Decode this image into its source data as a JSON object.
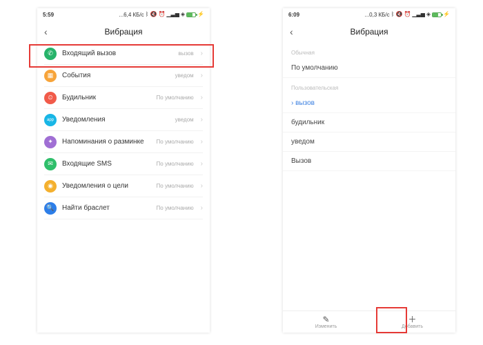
{
  "left": {
    "status": {
      "time": "5:59",
      "data": "...6,4 КБ/с"
    },
    "header": {
      "title": "Вибрация"
    },
    "rows": [
      {
        "icon": "phone",
        "color": "#27b36a",
        "label": "Входящий вызов",
        "value": "вызов"
      },
      {
        "icon": "cal",
        "color": "#f7a43a",
        "label": "События",
        "value": "уведом"
      },
      {
        "icon": "clock",
        "color": "#f15b4a",
        "label": "Будильник",
        "value": "По умолчанию"
      },
      {
        "icon": "app",
        "color": "#18b6e6",
        "label": "Уведомления",
        "value": "уведом"
      },
      {
        "icon": "bell",
        "color": "#a06fd4",
        "label": "Напоминания о разминке",
        "value": "По умолчанию"
      },
      {
        "icon": "sms",
        "color": "#2fbf6b",
        "label": "Входящие SMS",
        "value": "По умолчанию"
      },
      {
        "icon": "goal",
        "color": "#f4b02e",
        "label": "Уведомления о цели",
        "value": "По умолчанию"
      },
      {
        "icon": "find",
        "color": "#2d7ee8",
        "label": "Найти браслет",
        "value": "По умолчанию"
      }
    ]
  },
  "right": {
    "status": {
      "time": "6:09",
      "data": "...0,3 КБ/с"
    },
    "header": {
      "title": "Вибрация"
    },
    "section_default": "Обычная",
    "option_default": "По умолчанию",
    "section_custom": "Пользовательская",
    "custom": [
      {
        "label": "вызов",
        "selected": true
      },
      {
        "label": "будильник",
        "selected": false
      },
      {
        "label": "уведом",
        "selected": false
      },
      {
        "label": "Вызов",
        "selected": false
      }
    ],
    "bottom": {
      "edit": "Изменить",
      "add": "Добавить"
    }
  }
}
